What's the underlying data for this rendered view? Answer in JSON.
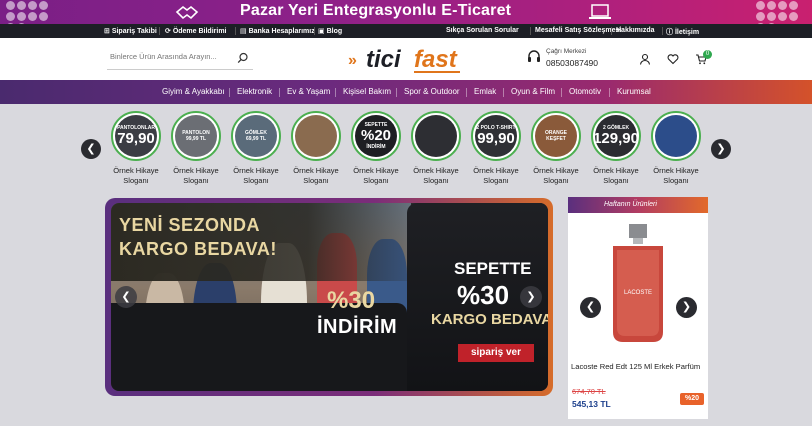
{
  "banner": {
    "title": "Pazar Yeri Entegrasyonlu E-Ticaret"
  },
  "topnav": {
    "left": [
      "Sipariş Takibi",
      "Ödeme Bildirimi",
      "Banka Hesaplarımız",
      "Blog"
    ],
    "right": [
      "Sıkça Sorulan Sorular",
      "Mesafeli Satış Sözleşmesi",
      "Hakkımızda",
      "İletişim"
    ]
  },
  "header": {
    "search_placeholder": "Binlerce Ürün Arasında Arayın...",
    "logo_part1": "tici",
    "logo_part2": "fast",
    "call_label": "Çağrı Merkezi",
    "call_number": "08503087490",
    "cart_count": "0"
  },
  "categories": [
    "Giyim & Ayakkabı",
    "Elektronik",
    "Ev & Yaşam",
    "Kişisel Bakım",
    "Spor & Outdoor",
    "Emlak",
    "Oyun & Film",
    "Otomotiv",
    "Kurumsal"
  ],
  "stories": [
    {
      "line1": "PANTOLONLAR",
      "big": "79,90",
      "line2": "",
      "caption1": "Örnek Hikaye",
      "caption2": "Sloganı",
      "bg": "#3b3d44"
    },
    {
      "line1": "PANTOLON",
      "big": "",
      "line2": "99,99 TL",
      "caption1": "Örnek Hikaye",
      "caption2": "Sloganı",
      "bg": "#6b6e74"
    },
    {
      "line1": "GÖMLEK",
      "big": "",
      "line2": "69,99 TL",
      "caption1": "Örnek Hikaye",
      "caption2": "Sloganı",
      "bg": "#5a6b7a"
    },
    {
      "line1": "",
      "big": "",
      "line2": "",
      "caption1": "Örnek Hikaye",
      "caption2": "Sloganı",
      "bg": "#8a6b4f"
    },
    {
      "line1": "SEPETTE",
      "big": "%20",
      "line2": "İNDİRİM",
      "caption1": "Örnek Hikaye",
      "caption2": "Sloganı",
      "bg": "#1e1f23"
    },
    {
      "line1": "",
      "big": "",
      "line2": "",
      "caption1": "Örnek Hikaye",
      "caption2": "Sloganı",
      "bg": "#2d2e33"
    },
    {
      "line1": "2 POLO T-SHIRT",
      "big": "99,90",
      "line2": "",
      "caption1": "Örnek Hikaye",
      "caption2": "Sloganı",
      "bg": "#2f3035"
    },
    {
      "line1": "ORANGE",
      "big": "",
      "line2": "KEŞFET",
      "caption1": "Örnek Hikaye",
      "caption2": "Sloganı",
      "bg": "#8a5a3a"
    },
    {
      "line1": "2 GÖMLEK",
      "big": "129,90",
      "line2": "",
      "caption1": "Örnek Hikaye",
      "caption2": "Sloganı",
      "bg": "#2b2c31"
    },
    {
      "line1": "",
      "big": "",
      "line2": "",
      "caption1": "Örnek Hikaye",
      "caption2": "Sloganı",
      "bg": "#2c4d8a"
    }
  ],
  "slider": {
    "headline1": "YENİ SEZONDA",
    "headline2": "KARGO BEDAVA!",
    "left_pct": "%30",
    "left_indirim": "İNDİRİM",
    "sepette": "SEPETTE",
    "right_pct": "%30",
    "right_kargo": "KARGO BEDAVA",
    "cta": "sipariş ver"
  },
  "week": {
    "title": "Haftanın Ürünleri",
    "product_name": "Lacoste Red Edt 125 Ml Erkek Parfüm",
    "old_price": "674,70 TL",
    "new_price": "545,13 TL",
    "discount": "%20",
    "bottle_label": "LACOSTE"
  }
}
